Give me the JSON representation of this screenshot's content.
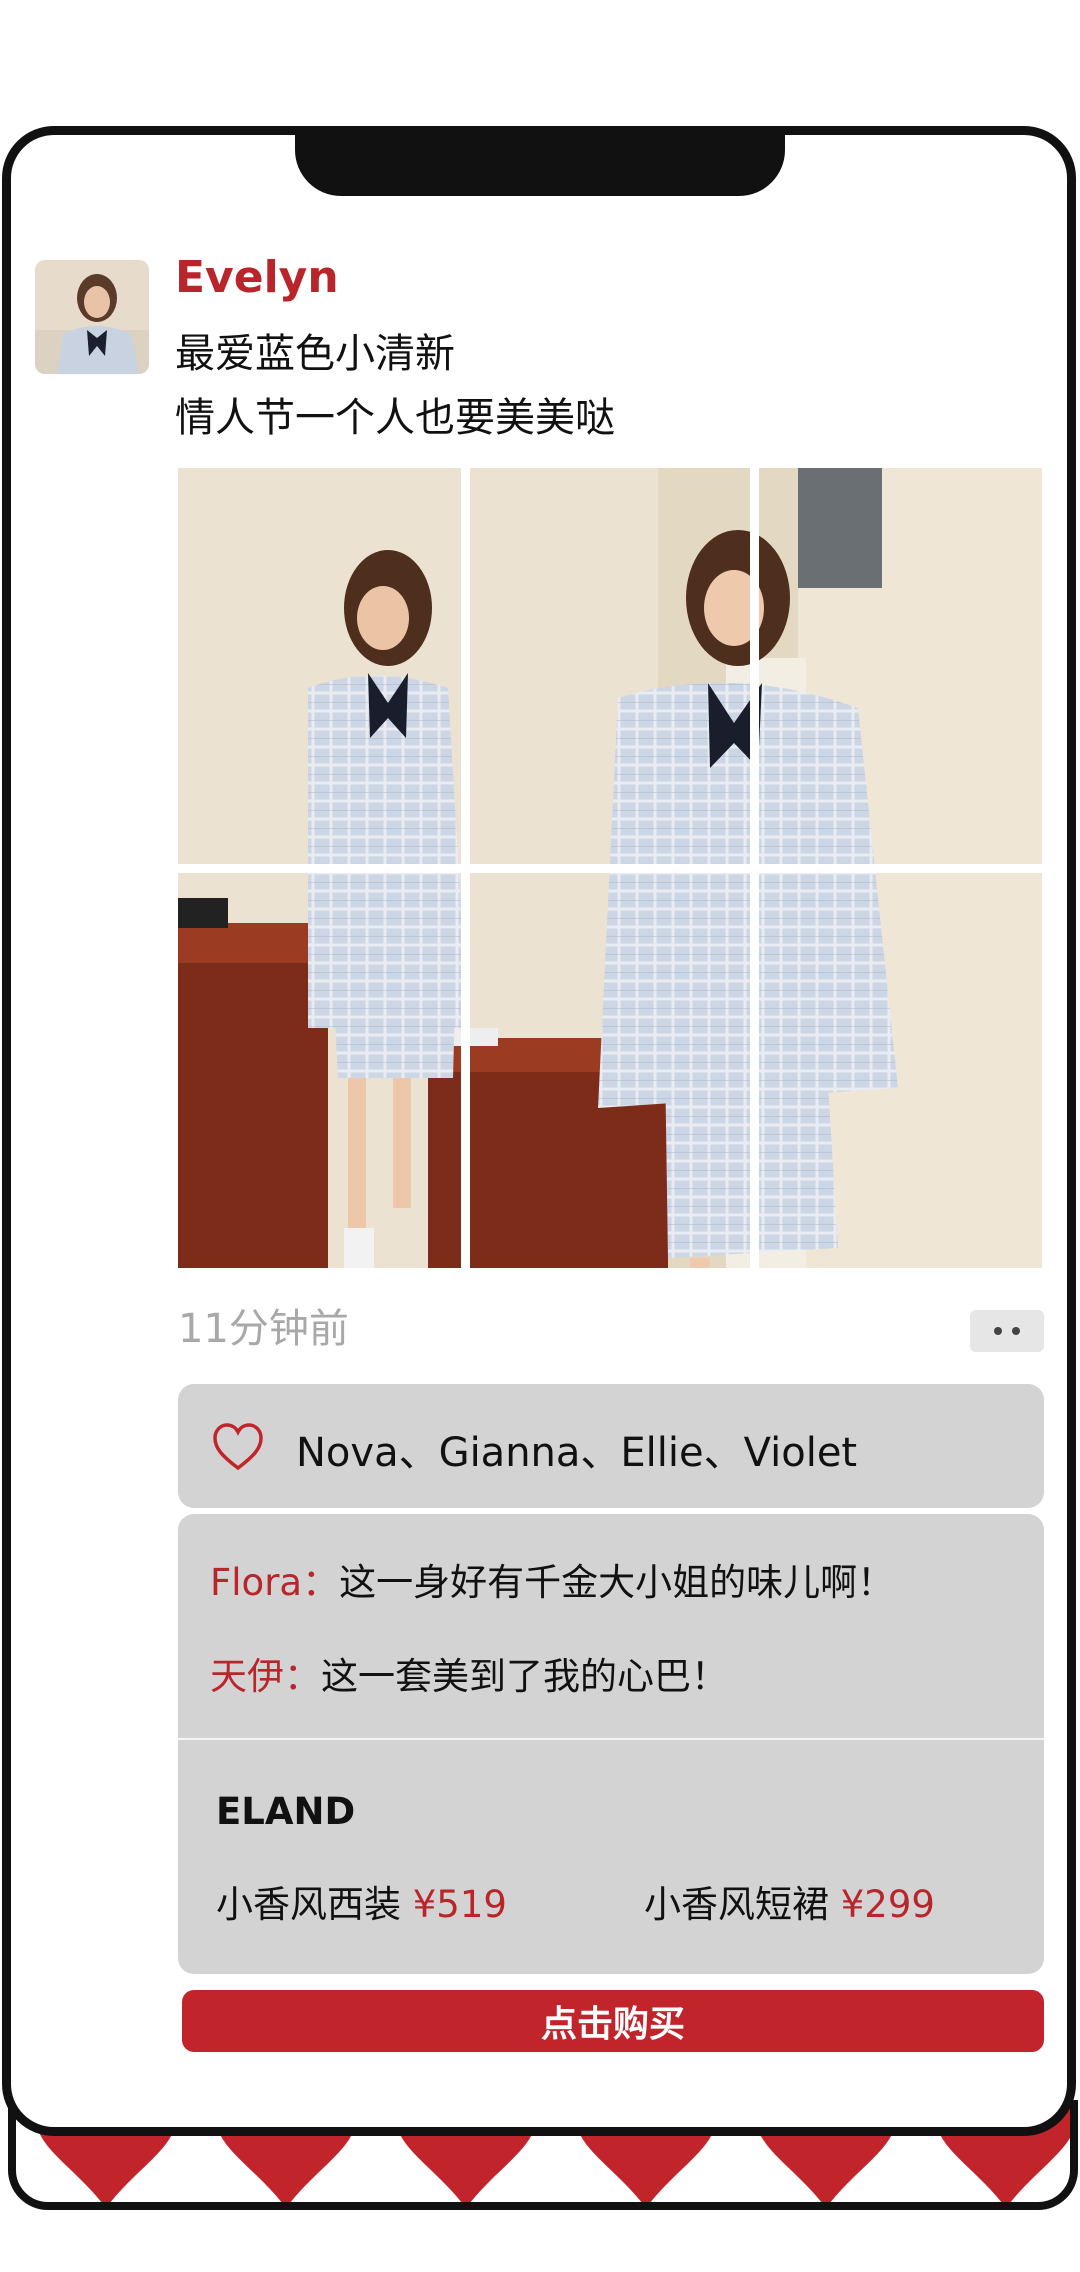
{
  "post": {
    "username": "Evelyn",
    "text_line1": "最爱蓝色小清新",
    "text_line2": "情人节一个人也要美美哒",
    "timestamp": "11分钟前"
  },
  "likes": {
    "names": "Nova、Gianna、Ellie、Violet"
  },
  "comments": [
    {
      "author": "Flora：",
      "text": "这一身好有千金大小姐的味儿啊！"
    },
    {
      "author": "天伊：",
      "text": "这一套美到了我的心巴！"
    }
  ],
  "product_card": {
    "brand": "ELAND",
    "items": [
      {
        "name": "小香风西装",
        "price": "¥519"
      },
      {
        "name": "小香风短裙",
        "price": "¥299"
      }
    ]
  },
  "cta": {
    "label": "点击购买"
  },
  "colors": {
    "accent": "#c2242b",
    "panel": "#d3d3d3",
    "muted_text": "#a8a8a8"
  },
  "icons": [
    "heart-icon",
    "more-dots-icon"
  ]
}
